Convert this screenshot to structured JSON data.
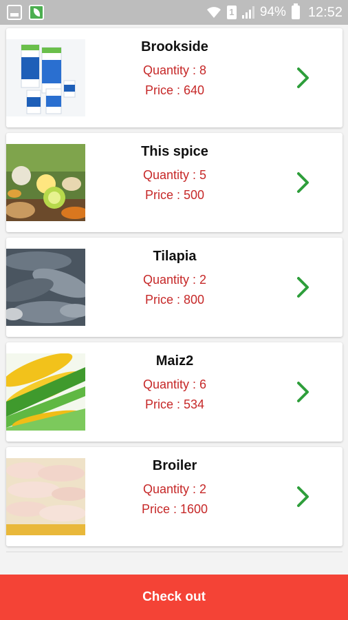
{
  "status_bar": {
    "battery_percent": "94%",
    "time": "12:52",
    "sim_slot": "1"
  },
  "products": [
    {
      "name": "Brookside",
      "quantity": "Quantity : 8",
      "price": "Price : 640",
      "image": "milk-cartons"
    },
    {
      "name": "This spice",
      "quantity": "Quantity : 5",
      "price": "Price : 500",
      "image": "spices"
    },
    {
      "name": "Tilapia",
      "quantity": "Quantity : 2",
      "price": "Price : 800",
      "image": "fish"
    },
    {
      "name": "Maiz2",
      "quantity": "Quantity : 6",
      "price": "Price : 534",
      "image": "corn"
    },
    {
      "name": "Broiler",
      "quantity": "Quantity : 2",
      "price": "Price : 1600",
      "image": "chicken"
    }
  ],
  "checkout": {
    "label": "Check out"
  },
  "colors": {
    "accent": "#f44336",
    "text_red": "#c62828",
    "chevron": "#2e9e3b",
    "status_bar": "#bdbdbd"
  }
}
